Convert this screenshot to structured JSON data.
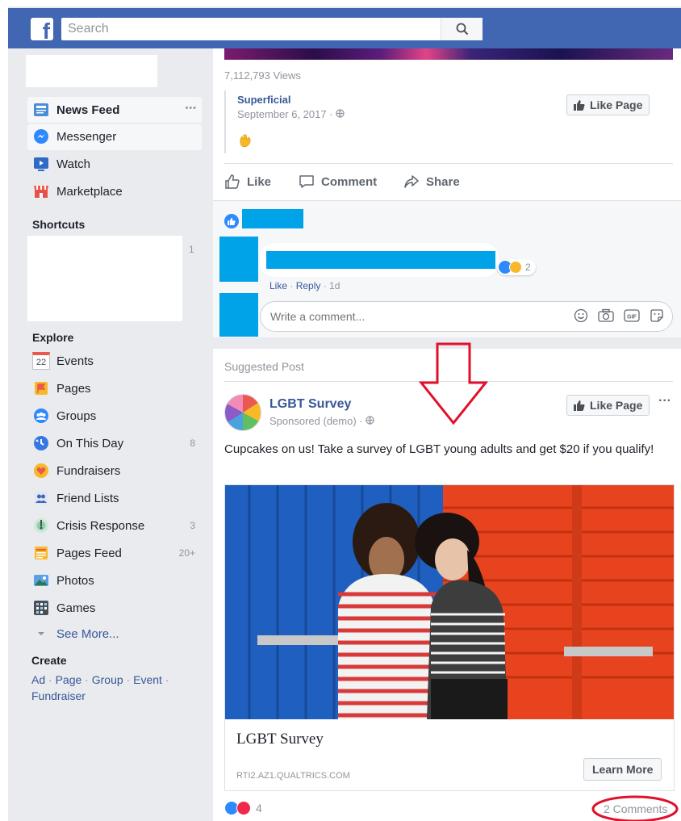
{
  "topbar": {
    "search_placeholder": "Search"
  },
  "sidebar": {
    "nav": [
      {
        "label": "News Feed",
        "icon": "news-feed-icon",
        "more": "•••"
      },
      {
        "label": "Messenger",
        "icon": "messenger-icon"
      },
      {
        "label": "Watch",
        "icon": "watch-icon"
      },
      {
        "label": "Marketplace",
        "icon": "marketplace-icon"
      }
    ],
    "shortcuts_title": "Shortcuts",
    "shortcuts_count": "1",
    "explore_title": "Explore",
    "explore": [
      {
        "label": "Events",
        "icon": "events-icon",
        "count": "",
        "date": "22"
      },
      {
        "label": "Pages",
        "icon": "pages-icon",
        "count": ""
      },
      {
        "label": "Groups",
        "icon": "groups-icon",
        "count": ""
      },
      {
        "label": "On This Day",
        "icon": "on-this-day-icon",
        "count": "8"
      },
      {
        "label": "Fundraisers",
        "icon": "fundraisers-icon",
        "count": ""
      },
      {
        "label": "Friend Lists",
        "icon": "friend-lists-icon",
        "count": ""
      },
      {
        "label": "Crisis Response",
        "icon": "crisis-response-icon",
        "count": "3"
      },
      {
        "label": "Pages Feed",
        "icon": "pages-feed-icon",
        "count": "20+"
      },
      {
        "label": "Photos",
        "icon": "photos-icon",
        "count": ""
      },
      {
        "label": "Games",
        "icon": "games-icon",
        "count": ""
      }
    ],
    "see_more": "See More...",
    "create_title": "Create",
    "create_links": [
      "Ad",
      "Page",
      "Group",
      "Event",
      "Fundraiser"
    ]
  },
  "post1": {
    "views": "7,112,793 Views",
    "page_name": "Superficial",
    "date": "September 6, 2017 · ",
    "like_page": "Like Page",
    "actions": {
      "like": "Like",
      "comment": "Comment",
      "share": "Share"
    },
    "comment_reaction_count": "2",
    "comment_meta": {
      "like": "Like",
      "reply": "Reply",
      "time": "1d"
    },
    "write_comment_placeholder": "Write a comment..."
  },
  "post2": {
    "header": "Suggested Post",
    "page_name": "LGBT Survey",
    "sponsored": "Sponsored (demo) · ",
    "like_page": "Like Page",
    "more": "···",
    "text": "Cupcakes on us! Take a survey of LGBT young adults and get $20 if you qualify!",
    "link_title": "LGBT Survey",
    "link_domain": "RTI2.AZ1.QUALTRICS.COM",
    "cta": "Learn More",
    "reaction_count": "4",
    "comments": "2 Comments"
  },
  "colors": {
    "brand": "#4267b2",
    "redaction": "#00a3e7",
    "annotation": "#e0102a"
  }
}
